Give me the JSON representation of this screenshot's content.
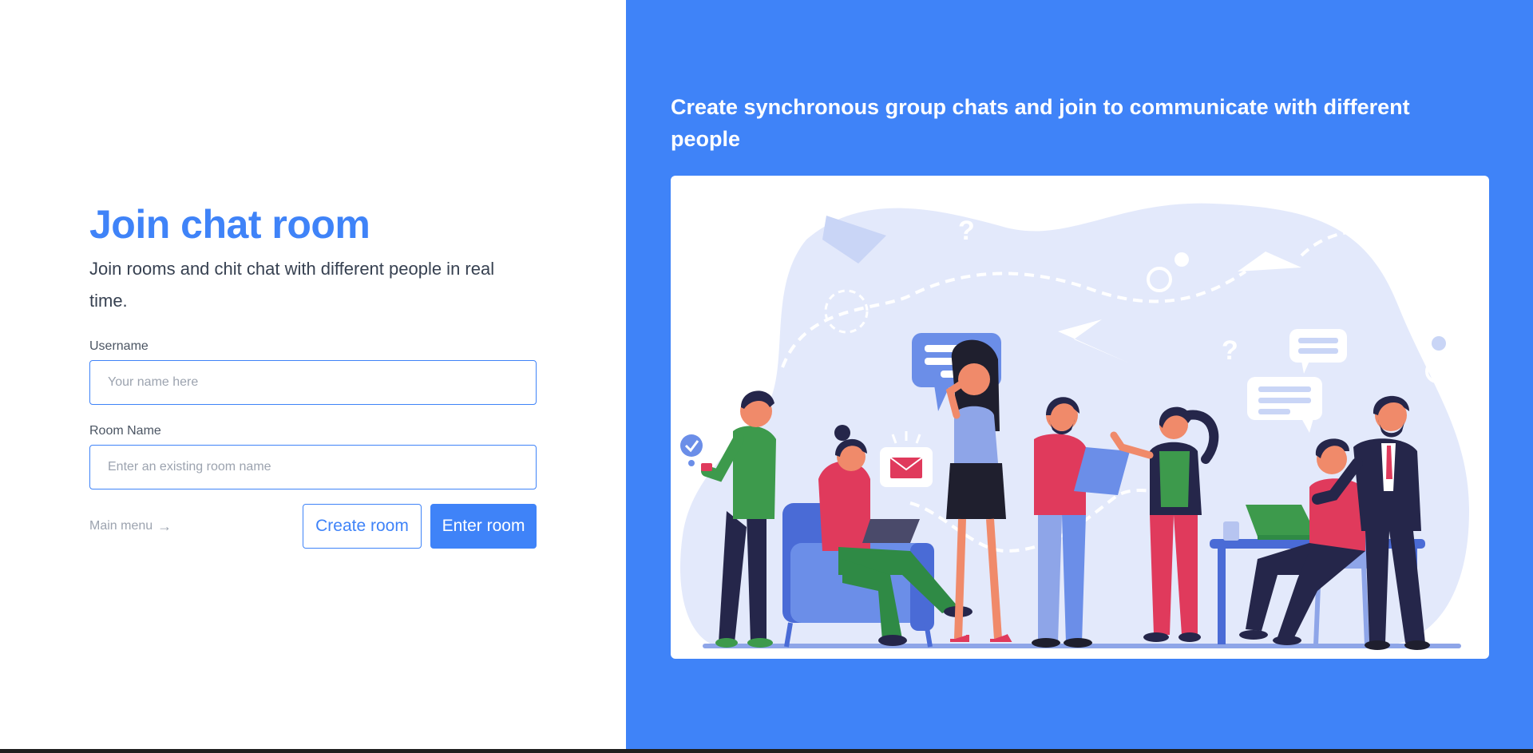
{
  "join": {
    "title": "Join chat room",
    "subtitle": "Join rooms and chit chat with different people in real time.",
    "username_label": "Username",
    "username_placeholder": "Your name here",
    "username_value": "",
    "room_label": "Room Name",
    "room_placeholder": "Enter an existing room name",
    "room_value": "",
    "main_menu_label": "Main menu",
    "main_menu_icon": "arrow-right-icon",
    "create_button": "Create room",
    "enter_button": "Enter room"
  },
  "hero": {
    "heading": "Create synchronous group chats and join to communicate with different people",
    "illustration": "group-chat-people-illustration"
  },
  "colors": {
    "accent": "#3f83f8",
    "right_panel_bg": "#3f83f8",
    "muted_text": "#9ca3af",
    "body_text": "#374151",
    "illustration_blob": "#e3e9fb",
    "illustration_dark": "#25264a",
    "illustration_red": "#e03a5c",
    "illustration_green": "#3d9a4c"
  }
}
